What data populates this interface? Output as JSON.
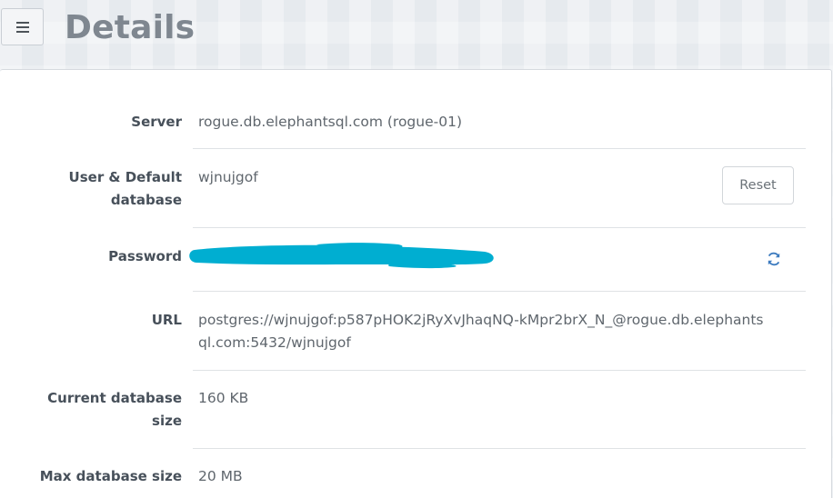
{
  "header": {
    "menu_icon": "hamburger-menu-icon",
    "title": "Details"
  },
  "details": {
    "server": {
      "label": "Server",
      "value": "rogue.db.elephantsql.com (rogue-01)"
    },
    "user": {
      "label_line1": "User & Default",
      "label_line2": "database",
      "value": "wjnujgof",
      "reset_label": "Reset"
    },
    "password": {
      "label": "Password",
      "redacted": true,
      "redaction_color": "#00aed1",
      "refresh_icon": "refresh-icon"
    },
    "url": {
      "label": "URL",
      "value_line1": "postgres://wjnujgof:p587pHOK2jRyXvJhaqNQ-kMpr2brX_N_@rogue.db.elephants",
      "value_line2": "ql.com:5432/wjnujgof"
    },
    "current_size": {
      "label_line1": "Current database",
      "label_line2": "size",
      "value": "160 KB"
    },
    "max_size": {
      "label": "Max database size",
      "value": "20 MB"
    }
  },
  "colors": {
    "accent": "#00aed1",
    "label_text": "#47505a",
    "value_text": "#5f666d",
    "title_text": "#7f8790"
  }
}
